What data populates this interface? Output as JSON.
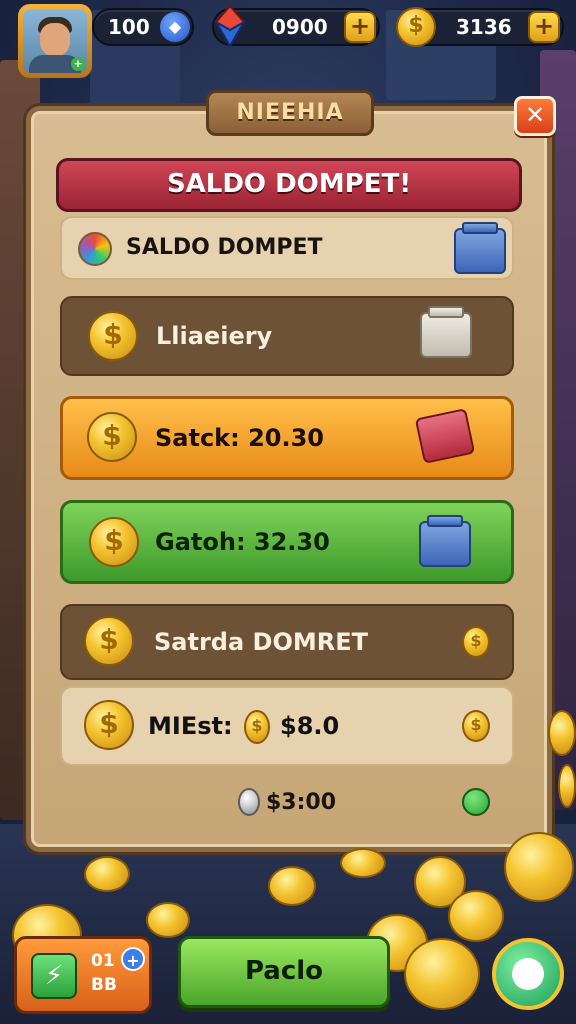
{
  "top_bar": {
    "level_value": "100",
    "gems_value": "0900",
    "coins_value": "3136",
    "plus_symbol": "+"
  },
  "panel": {
    "ribbon_title": "NIEEHIA",
    "close_symbol": "✕",
    "header_title": "SALDO DOMPET!"
  },
  "rows": [
    {
      "label": "SALDO DOMPET",
      "icon": "palette-icon"
    },
    {
      "label": "Lliaeiery",
      "icon": "coin-icon"
    },
    {
      "label": "Satck: 20.30",
      "icon": "coin-icon"
    },
    {
      "label": "Gatoh: 32.30",
      "icon": "coin-icon"
    },
    {
      "label": "Satrda DOMRET",
      "icon": "coin-icon"
    },
    {
      "label": "MIEst:",
      "value": "$8.0",
      "icon": "coin-icon"
    }
  ],
  "footer": {
    "text": "$3:00"
  },
  "bottom": {
    "left_top": "01",
    "left_bottom": "BB",
    "main_button_label": "Paclo"
  },
  "colors": {
    "accent_red": "#c93a4a",
    "accent_orange": "#f2a62a",
    "accent_green": "#5cb83a",
    "panel_bg": "#d3b78b"
  }
}
